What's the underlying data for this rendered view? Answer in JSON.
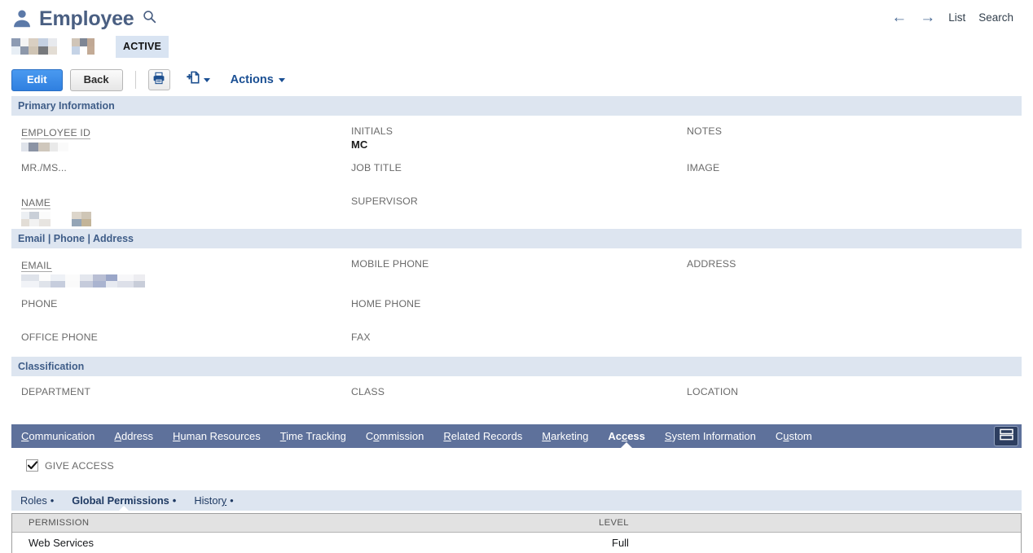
{
  "header": {
    "title": "Employee",
    "person_icon": "person-icon",
    "search_icon": "search-icon",
    "status_badge": "ACTIVE",
    "nav": {
      "back_arrow": "←",
      "forward_arrow": "→",
      "list_label": "List",
      "search_label": "Search"
    }
  },
  "toolbar": {
    "edit_label": "Edit",
    "back_label": "Back",
    "print_icon": "printer-icon",
    "new_icon": "new-document-icon",
    "actions_label": "Actions"
  },
  "sections": [
    {
      "title": "Primary Information",
      "rows": [
        [
          {
            "label": "EMPLOYEE ID",
            "value": "",
            "redacted": true,
            "link": true
          },
          {
            "label": "INITIALS",
            "value": "MC",
            "redacted": false,
            "link": false
          },
          {
            "label": "NOTES",
            "value": "",
            "redacted": false,
            "link": false
          }
        ],
        [
          {
            "label": "MR./MS...",
            "value": "",
            "redacted": false,
            "link": false
          },
          {
            "label": "JOB TITLE",
            "value": "",
            "redacted": false,
            "link": false
          },
          {
            "label": "IMAGE",
            "value": "",
            "redacted": false,
            "link": false
          }
        ],
        [
          {
            "label": "NAME",
            "value": "",
            "redacted": true,
            "link": true
          },
          {
            "label": "SUPERVISOR",
            "value": "",
            "redacted": false,
            "link": false
          },
          {
            "label": "",
            "value": "",
            "redacted": false,
            "link": false
          }
        ]
      ]
    },
    {
      "title": "Email | Phone | Address",
      "rows": [
        [
          {
            "label": "EMAIL",
            "value": "",
            "redacted": true,
            "link": true
          },
          {
            "label": "MOBILE PHONE",
            "value": "",
            "redacted": false,
            "link": false
          },
          {
            "label": "ADDRESS",
            "value": "",
            "redacted": false,
            "link": false
          }
        ],
        [
          {
            "label": "PHONE",
            "value": "",
            "redacted": false,
            "link": false
          },
          {
            "label": "HOME PHONE",
            "value": "",
            "redacted": false,
            "link": false
          },
          {
            "label": "",
            "value": "",
            "redacted": false,
            "link": false
          }
        ],
        [
          {
            "label": "OFFICE PHONE",
            "value": "",
            "redacted": false,
            "link": false
          },
          {
            "label": "FAX",
            "value": "",
            "redacted": false,
            "link": false
          },
          {
            "label": "",
            "value": "",
            "redacted": false,
            "link": false
          }
        ]
      ]
    },
    {
      "title": "Classification",
      "rows": [
        [
          {
            "label": "DEPARTMENT",
            "value": "",
            "redacted": false,
            "link": false
          },
          {
            "label": "CLASS",
            "value": "",
            "redacted": false,
            "link": false
          },
          {
            "label": "LOCATION",
            "value": "",
            "redacted": false,
            "link": false
          }
        ]
      ]
    }
  ],
  "tabs": [
    {
      "label": "Communication",
      "accesskey_index": 0,
      "active": false
    },
    {
      "label": "Address",
      "accesskey_index": 0,
      "active": false
    },
    {
      "label": "Human Resources",
      "accesskey_index": 0,
      "active": false
    },
    {
      "label": "Time Tracking",
      "accesskey_index": 0,
      "active": false
    },
    {
      "label": "Commission",
      "accesskey_index": 1,
      "active": false
    },
    {
      "label": "Related Records",
      "accesskey_index": 0,
      "active": false
    },
    {
      "label": "Marketing",
      "accesskey_index": 0,
      "active": false
    },
    {
      "label": "Access",
      "accesskey_index": 2,
      "active": true
    },
    {
      "label": "System Information",
      "accesskey_index": 0,
      "active": false
    },
    {
      "label": "Custom",
      "accesskey_index": 1,
      "active": false
    }
  ],
  "tabbar_tool_icon": "layout-toggle-icon",
  "access": {
    "give_access_label": "GIVE ACCESS",
    "give_access_checked": true,
    "check_icon": "checkmark-icon",
    "subtabs": [
      {
        "label": "Roles",
        "bullet": "•",
        "accesskey_index": -1,
        "active": false
      },
      {
        "label": "Global Permissions",
        "bullet": "•",
        "accesskey_index": -1,
        "active": true
      },
      {
        "label": "History",
        "bullet": "•",
        "accesskey_index": 6,
        "active": false
      }
    ],
    "table": {
      "columns": [
        "PERMISSION",
        "LEVEL"
      ],
      "rows": [
        {
          "permission": "Web Services",
          "level": "Full"
        }
      ]
    }
  },
  "colors": {
    "title": "#4a5f82",
    "section_header_bg": "#dde5f0",
    "section_header_text": "#3f5d88",
    "tabbar_bg": "#5e719b",
    "primary_button": "#2f7fe0",
    "badge_bg": "#d9e4f2",
    "link": "#1a4f93"
  }
}
